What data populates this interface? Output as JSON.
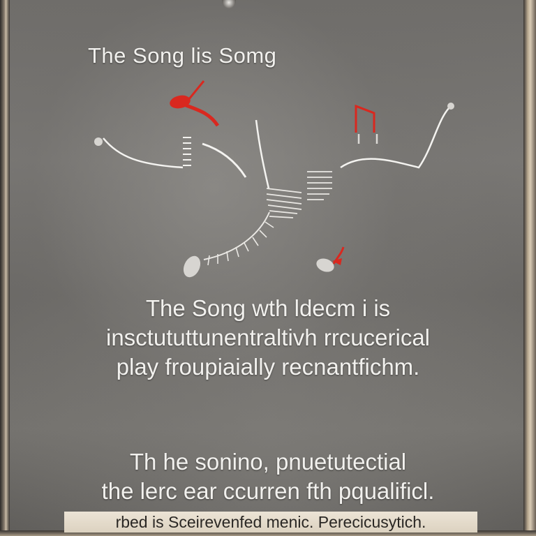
{
  "poster": {
    "title": "The  Song  lis Somg",
    "paragraph1": [
      "The Song wth ldecm i is",
      "insctututtunentraltivh rrcucerical",
      "play froupiaially recnantfichm."
    ],
    "paragraph2": [
      "Th  he sonino, pnuetutectial",
      "the lerc ear  ccurren fth pqualificl."
    ],
    "footer_banner": "rbed is Sceirevenfed menic. Perecicusytich."
  },
  "illustration": {
    "icon": "music-notes-icon",
    "accent_color": "#d9281f",
    "line_color": "#f4f3f0"
  }
}
